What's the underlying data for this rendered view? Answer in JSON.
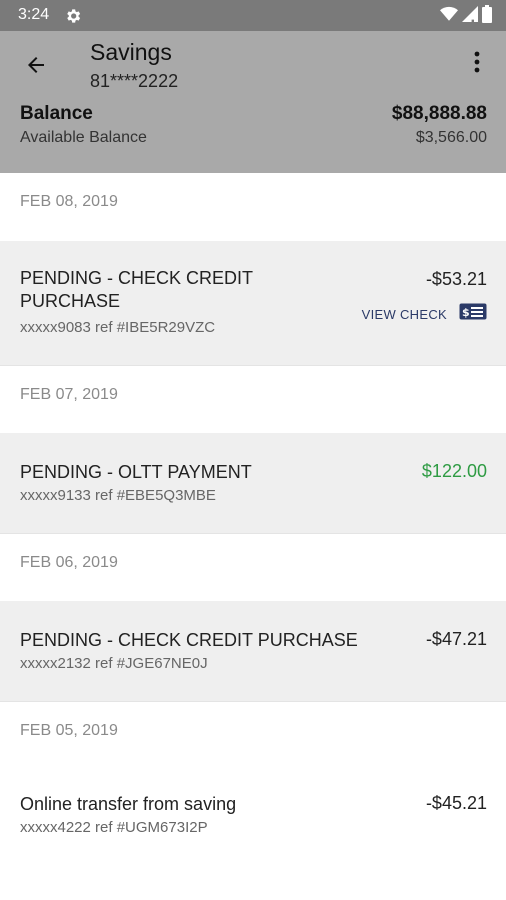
{
  "status_bar": {
    "time": "3:24"
  },
  "header": {
    "title": "Savings",
    "account_number": "81****2222",
    "balance_label": "Balance",
    "balance_value": "$88,888.88",
    "available_label": "Available Balance",
    "available_value": "$3,566.00"
  },
  "groups": [
    {
      "date": "FEB 08, 2019",
      "transactions": [
        {
          "description": "PENDING - CHECK CREDIT PURCHASE",
          "reference": "xxxxx9083 ref #IBE5R29VZC",
          "amount": "-$53.21",
          "view_check_label": "VIEW CHECK"
        }
      ]
    },
    {
      "date": "FEB 07, 2019",
      "transactions": [
        {
          "description": "PENDING - OLTT PAYMENT",
          "reference": "xxxxx9133 ref #EBE5Q3MBE",
          "amount": "$122.00"
        }
      ]
    },
    {
      "date": "FEB 06, 2019",
      "transactions": [
        {
          "description": "PENDING - CHECK CREDIT PURCHASE",
          "reference": "xxxxx2132 ref #JGE67NE0J",
          "amount": "-$47.21"
        }
      ]
    },
    {
      "date": "FEB 05, 2019",
      "transactions": [
        {
          "description": "Online transfer from saving",
          "reference": "xxxxx4222 ref #UGM673I2P",
          "amount": "-$45.21"
        }
      ]
    }
  ],
  "colors": {
    "credit": "#2e9b43",
    "header_bg": "#a9a9a9",
    "status_bg": "#7a7a7a"
  },
  "icons": [
    "gear-icon",
    "wifi-icon",
    "signal-icon",
    "battery-icon",
    "back-arrow-icon",
    "more-vert-icon",
    "check-icon"
  ]
}
